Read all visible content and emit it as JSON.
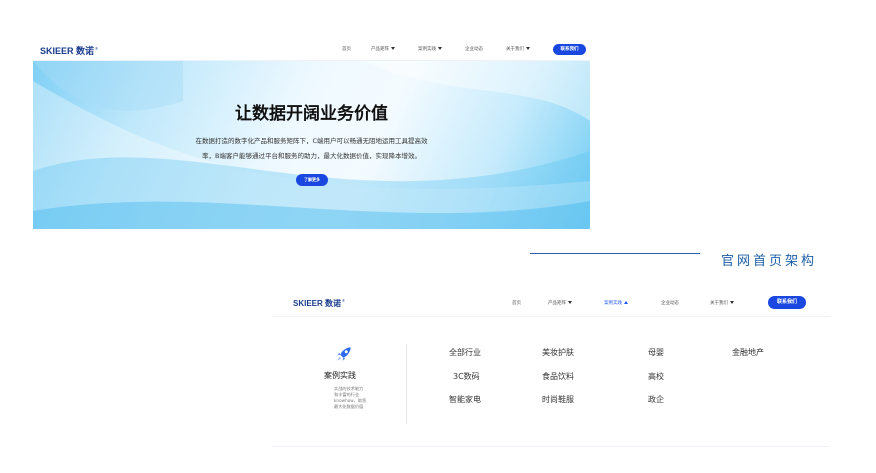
{
  "brand": {
    "name": "SKIEER 数诺",
    "mark": "®",
    "color": "#1a3d8f"
  },
  "accent_color": "#1a47e0",
  "home": {
    "nav": [
      {
        "label": "首页",
        "dropdown": false
      },
      {
        "label": "产品矩阵",
        "dropdown": true
      },
      {
        "label": "案例实践",
        "dropdown": true
      },
      {
        "label": "企业动态",
        "dropdown": false
      },
      {
        "label": "关于我们",
        "dropdown": true
      }
    ],
    "contact_label": "联系我们",
    "hero": {
      "title": "让数据开阔业务价值",
      "desc_line1": "在数据打造的数字化产品和服务矩阵下，C端用户可以畅通无阻地运用工具提高效",
      "desc_line2": "率，B端客户能够通过平台和服务的助力，最大化数据价值，实现降本增效。",
      "button_label": "了解更多"
    }
  },
  "caption": "官网首页架构",
  "dropdown_page": {
    "nav": [
      {
        "label": "首页",
        "dropdown": false,
        "active": false
      },
      {
        "label": "产品矩阵",
        "dropdown": true,
        "active": false
      },
      {
        "label": "案例实践",
        "dropdown": true,
        "active": true
      },
      {
        "label": "企业动态",
        "dropdown": false,
        "active": false
      },
      {
        "label": "关于我们",
        "dropdown": true,
        "active": false
      }
    ],
    "contact_label": "联系我们",
    "category": {
      "icon": "rocket-icon",
      "title": "案例实践",
      "desc": [
        "实战的技术能力",
        "和丰富的行业",
        "knowhow，助您",
        "最大化数据价值"
      ]
    },
    "industries": [
      [
        "全部行业",
        "美妆护肤",
        "母婴",
        "金融地产"
      ],
      [
        "3C数码",
        "食品饮料",
        "高校"
      ],
      [
        "智能家电",
        "时尚鞋服",
        "政企"
      ]
    ]
  }
}
